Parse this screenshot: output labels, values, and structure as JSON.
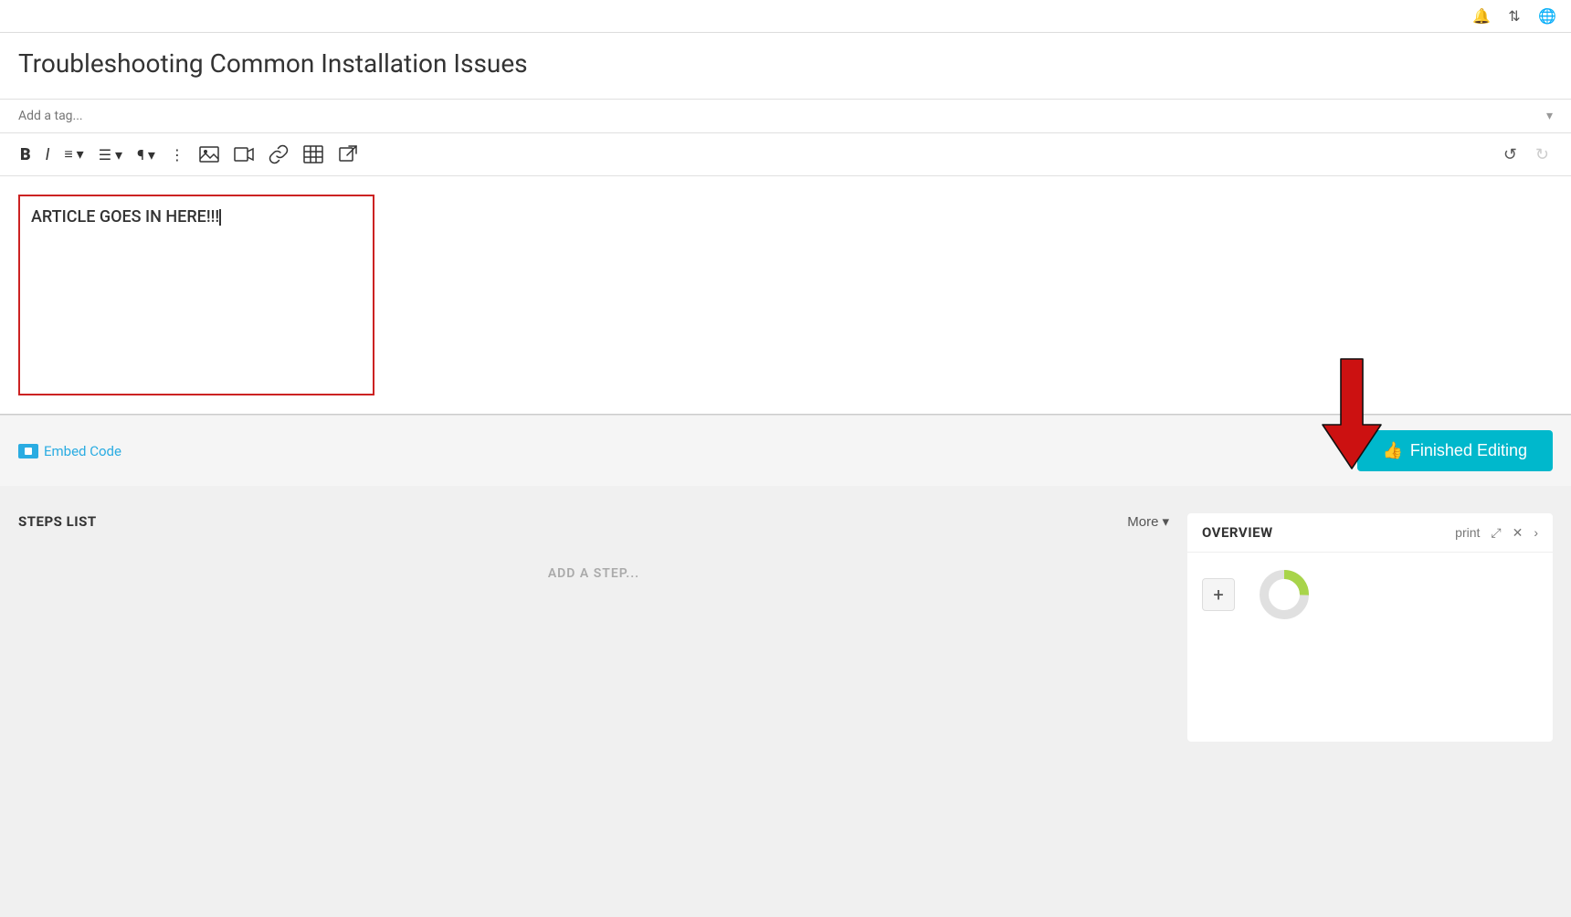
{
  "topbar": {
    "bell_icon": "🔔",
    "sort_icon": "⇅",
    "globe_icon": "🌐"
  },
  "editor": {
    "title": "Troubleshooting Common Installation Issues",
    "tag_placeholder": "Add a tag...",
    "content_text": "ARTICLE GOES IN HERE!!!",
    "toolbar": {
      "bold": "B",
      "italic": "I",
      "ordered_list": "≡",
      "unordered_list": "≡",
      "paragraph": "¶",
      "more": "⋮",
      "image": "🖼",
      "video": "📷",
      "link": "🔗",
      "table": "⊞",
      "external": "⧉",
      "undo": "↺",
      "redo": "↻"
    }
  },
  "footer": {
    "embed_code_label": "Embed Code",
    "finished_editing_label": "Finished Editing"
  },
  "steps_panel": {
    "title": "STEPS LIST",
    "more_label": "More",
    "add_step_label": "ADD A STEP..."
  },
  "overview_panel": {
    "title": "OVERVIEW",
    "print_label": "print",
    "close_icon": "✕",
    "next_icon": "›",
    "add_icon": "+"
  }
}
